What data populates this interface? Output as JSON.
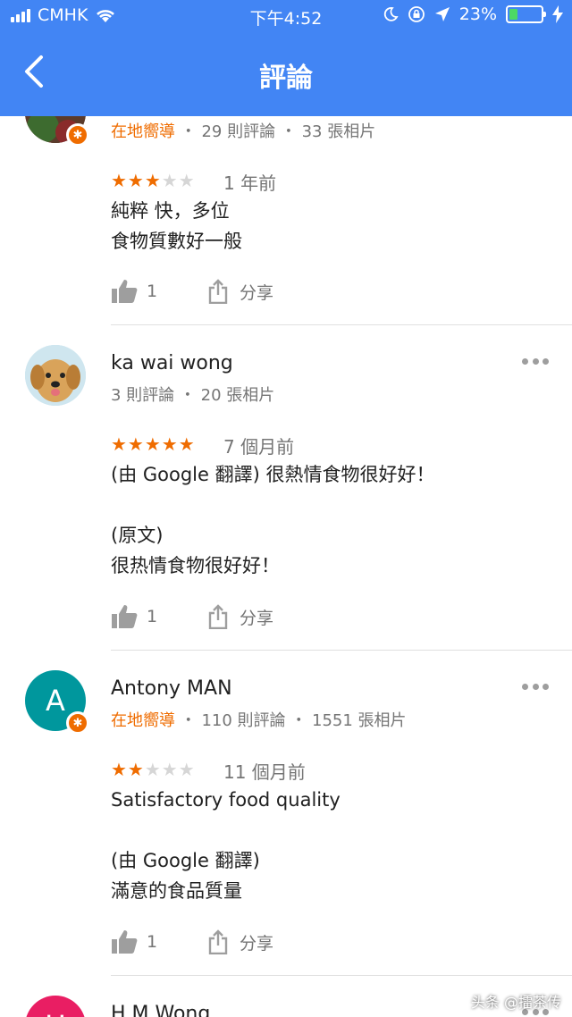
{
  "status_bar": {
    "carrier": "CMHK",
    "time": "下午4:52",
    "battery": "23%"
  },
  "header": {
    "title": "評論"
  },
  "reviews": [
    {
      "name": "",
      "guide": "在地嚮導",
      "review_count": "29 則評論",
      "photo_count": "33 張相片",
      "rating": 3,
      "stars_on": "★★★",
      "stars_off": "★★",
      "when": "1 年前",
      "lines": [
        "純粹 快，多位",
        "食物質數好一般"
      ],
      "likes": "1",
      "share": "分享"
    },
    {
      "name": "ka wai wong",
      "guide": "",
      "review_count": "3 則評論",
      "photo_count": "20 張相片",
      "rating": 5,
      "stars_on": "★★★★★",
      "stars_off": "",
      "when": "7 個月前",
      "lines": [
        "(由 Google 翻譯) 很熱情食物很好好！",
        "",
        "(原文)",
        "很热情食物很好好！"
      ],
      "likes": "1",
      "share": "分享"
    },
    {
      "name": "Antony MAN",
      "avatar_letter": "A",
      "guide": "在地嚮導",
      "review_count": "110 則評論",
      "photo_count": "1551 張相片",
      "rating": 2,
      "stars_on": "★★",
      "stars_off": "★★★",
      "when": "11 個月前",
      "lines": [
        "Satisfactory food quality",
        "",
        "(由 Google 翻譯)",
        "滿意的食品質量"
      ],
      "likes": "1",
      "share": "分享"
    },
    {
      "name": "H M Wong",
      "avatar_letter": "H"
    }
  ],
  "separator": "・",
  "watermark": "头条 @擂茶传",
  "colors": {
    "header": "#4285f4",
    "star": "#ef6c00",
    "guide": "#ef6c00",
    "avatar_teal": "#00979d",
    "avatar_pink": "#e91e63"
  }
}
